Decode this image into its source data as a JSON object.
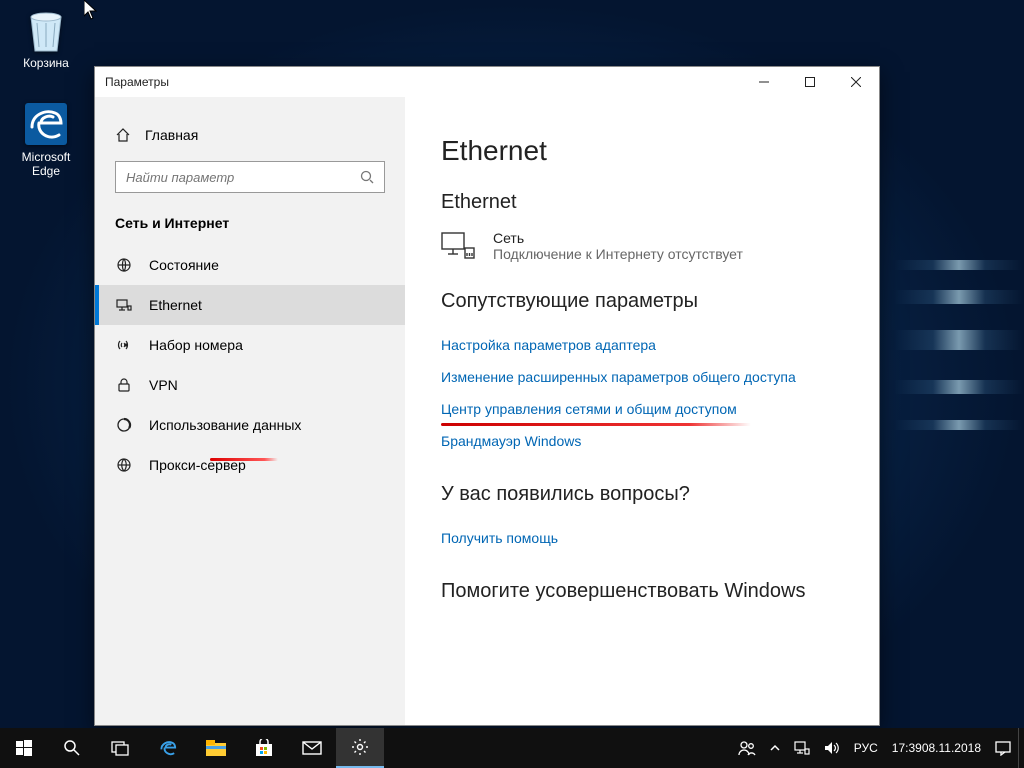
{
  "desktop": {
    "recycle_bin": "Корзина",
    "edge": "Microsoft Edge"
  },
  "window": {
    "title": "Параметры"
  },
  "sidebar": {
    "home": "Главная",
    "search_placeholder": "Найти параметр",
    "category": "Сеть и Интернет",
    "items": [
      {
        "label": "Состояние"
      },
      {
        "label": "Ethernet"
      },
      {
        "label": "Набор номера"
      },
      {
        "label": "VPN"
      },
      {
        "label": "Использование данных"
      },
      {
        "label": "Прокси-сервер"
      }
    ]
  },
  "content": {
    "h1": "Ethernet",
    "sub_ethernet": "Ethernet",
    "net_name": "Сеть",
    "net_status": "Подключение к Интернету отсутствует",
    "related_header": "Сопутствующие параметры",
    "links": {
      "adapter": "Настройка параметров адаптера",
      "sharing": "Изменение расширенных параметров общего доступа",
      "center": "Центр управления сетями и общим доступом",
      "firewall": "Брандмауэр Windows"
    },
    "questions_header": "У вас появились вопросы?",
    "get_help": "Получить помощь",
    "improve_header": "Помогите усовершенствовать Windows"
  },
  "taskbar": {
    "lang": "РУС",
    "time": "17:39",
    "date": "08.11.2018"
  }
}
